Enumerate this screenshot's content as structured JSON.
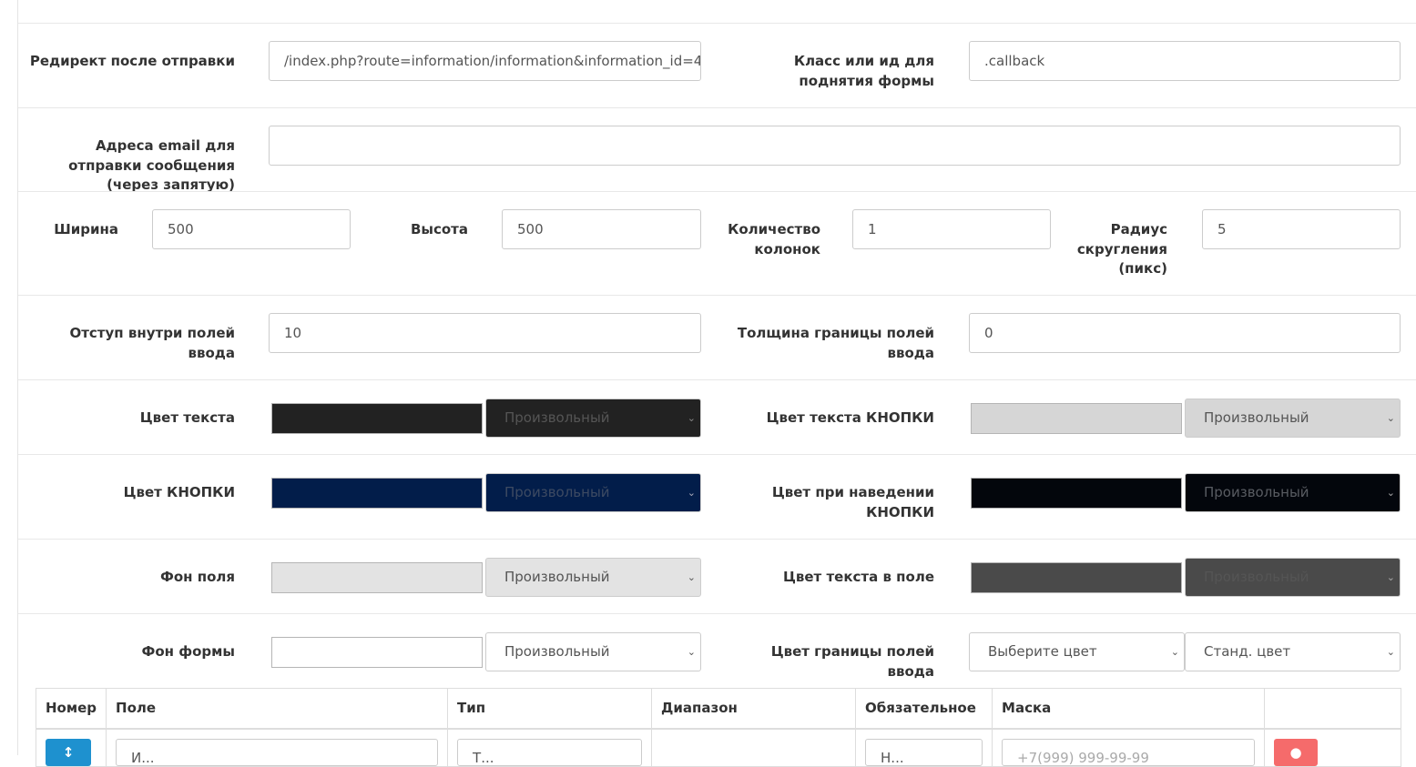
{
  "rows": {
    "redirect": {
      "label": "Редирект после отправки",
      "value": "/index.php?route=information/information&information_id=4"
    },
    "trigger": {
      "label": "Класс или ид для поднятия формы",
      "value": ".callback"
    },
    "emails": {
      "label": "Адреса email для отправки сообщения (через запятую)",
      "value": ""
    },
    "width": {
      "label": "Ширина",
      "value": "500"
    },
    "height": {
      "label": "Высота",
      "value": "500"
    },
    "columns": {
      "label": "Количество колонок",
      "value": "1"
    },
    "radius": {
      "label": "Радиус скругления (пикс)",
      "value": "5"
    },
    "padding": {
      "label": "Отступ внутри полей ввода",
      "value": "10"
    },
    "border_width": {
      "label": "Толщина границы полей ввода",
      "value": "0"
    }
  },
  "colors": {
    "text_color": {
      "label": "Цвет текста",
      "swatch": "#222222",
      "select": "Произвольный",
      "select_bg": "#222222",
      "select_fg": "#555555"
    },
    "button_text_color": {
      "label": "Цвет текста КНОПКИ",
      "swatch": "#d6d6d6",
      "select": "Произвольный",
      "select_bg": "#d6d6d6",
      "select_fg": "#555555"
    },
    "button_color": {
      "label": "Цвет КНОПКИ",
      "swatch": "#021d4a",
      "select": "Произвольный",
      "select_bg": "#021d4a",
      "select_fg": "#3d4a62"
    },
    "hover_color": {
      "label": "Цвет при наведении КНОПКИ",
      "swatch": "#03060c",
      "select": "Произвольный",
      "select_bg": "#03060c",
      "select_fg": "#595c62"
    },
    "field_bg": {
      "label": "Фон поля",
      "swatch": "#e3e3e3",
      "select": "Произвольный",
      "select_bg": "#e3e3e3",
      "select_fg": "#555555"
    },
    "field_text_color": {
      "label": "Цвет текста в поле",
      "swatch": "#4a4a4a",
      "select": "Произвольный",
      "select_bg": "#4a4a4a",
      "select_fg": "#555555"
    },
    "form_bg": {
      "label": "Фон формы",
      "swatch": "#ffffff",
      "select": "Произвольный",
      "select_bg": "#ffffff",
      "select_fg": "#555555"
    },
    "border_color": {
      "label": "Цвет границы полей ввода",
      "select1": "Выберите цвет",
      "select2": "Станд. цвет"
    }
  },
  "table": {
    "headers": [
      "Номер",
      "Поле",
      "Тип",
      "Диапазон",
      "Обязательное",
      "Маска",
      ""
    ],
    "row1": {
      "field": "И...",
      "type": "Т...",
      "required": "Н...",
      "mask": "+7(999) 999-99-99"
    }
  }
}
